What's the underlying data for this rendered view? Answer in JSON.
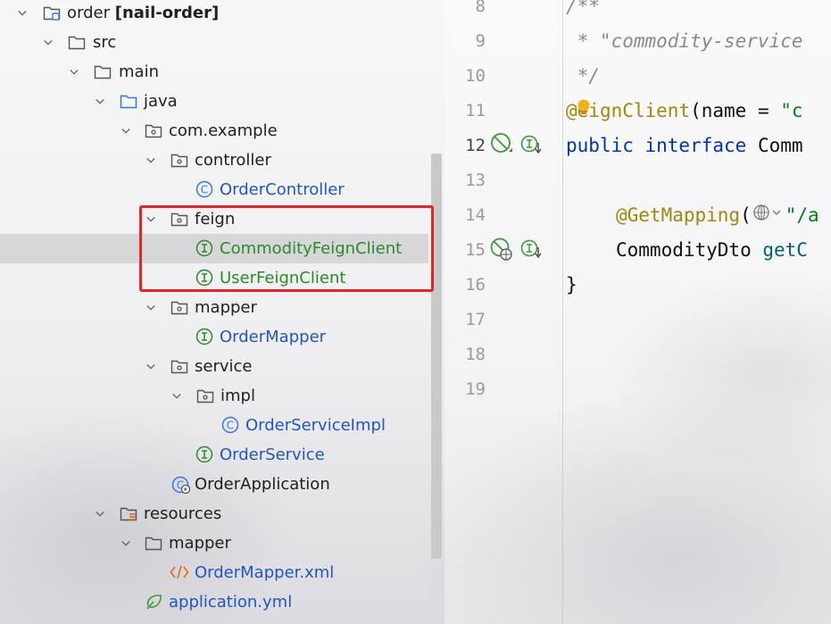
{
  "tree": {
    "root_name": "order",
    "root_module": "[nail-order]",
    "src": "src",
    "main": "main",
    "java": "java",
    "pkg": "com.example",
    "controller": "controller",
    "order_controller": "OrderController",
    "feign": "feign",
    "commodity_feign_client": "CommodityFeignClient",
    "user_feign_client": "UserFeignClient",
    "mapper": "mapper",
    "order_mapper": "OrderMapper",
    "service": "service",
    "impl": "impl",
    "order_service_impl": "OrderServiceImpl",
    "order_service": "OrderService",
    "order_application": "OrderApplication",
    "resources": "resources",
    "res_mapper": "mapper",
    "order_mapper_xml": "OrderMapper.xml",
    "application_yml": "application.yml"
  },
  "editor": {
    "line_numbers": [
      "8",
      "9",
      "10",
      "11",
      "12",
      "13",
      "14",
      "15",
      "16",
      "17",
      "18",
      "19"
    ],
    "lines": {
      "l8": "/**",
      "l9": " * \"commodity-service",
      "l10": " */",
      "l11_at": "@",
      "l11_ann": "eignClient",
      "l11_rest": "(name = ",
      "l11_str": "\"c",
      "l12_kw": "public interface ",
      "l12_name": "Comm",
      "l14_ann": "@GetMapping",
      "l14_paren": "(",
      "l14_str": "\"/a",
      "l15_type": "CommodityDto ",
      "l15_fn": "getC",
      "l16": "}"
    }
  },
  "colors": {
    "highlight_box": "#e0262a",
    "class_name": "#2155c4",
    "interface_name": "#2a8a2a"
  }
}
